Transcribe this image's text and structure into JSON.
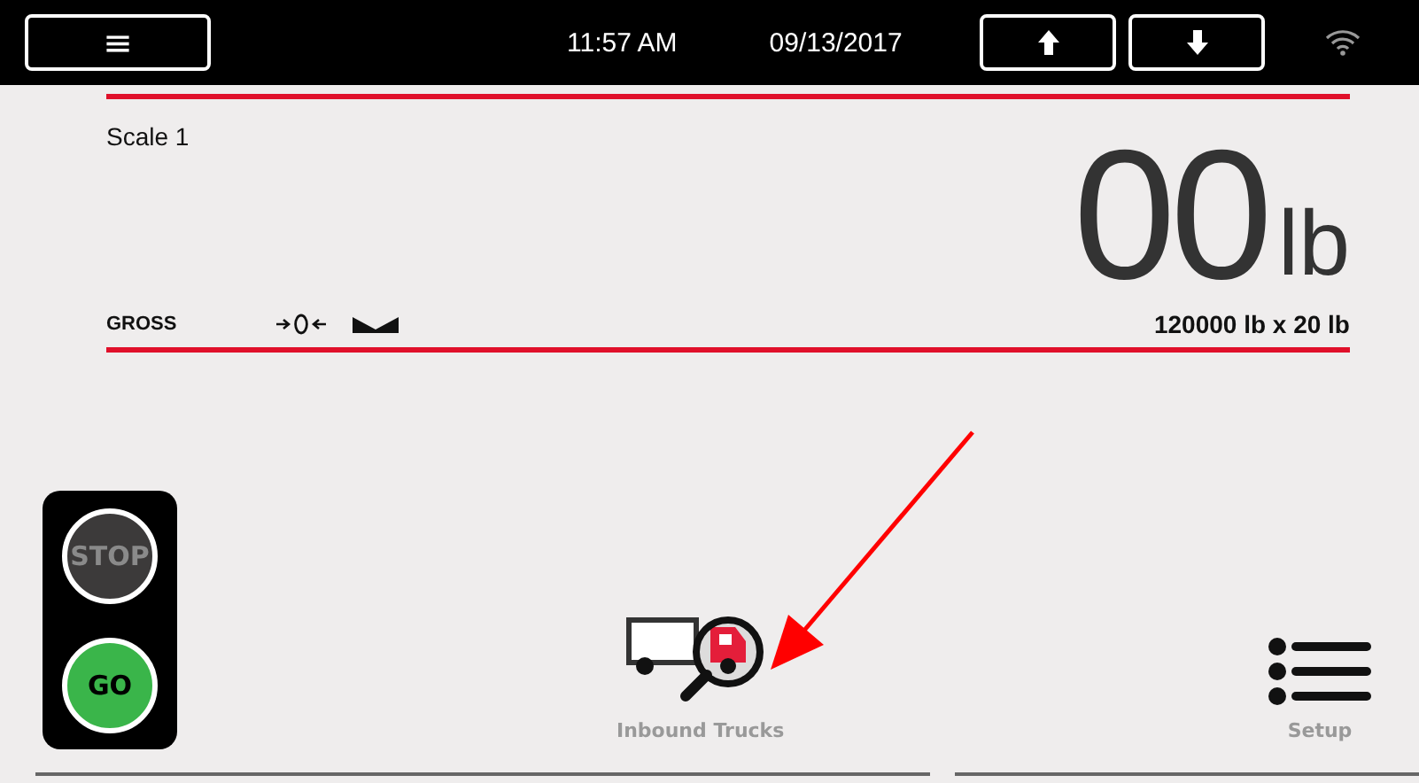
{
  "top_bar": {
    "time": "11:57 AM",
    "date": "09/13/2017",
    "menu_icon": "≡"
  },
  "scale": {
    "name": "Scale 1",
    "weight": "00",
    "unit": "lb",
    "mode": "GROSS",
    "capacity": "120000 lb x 20 lb"
  },
  "traffic_light": [
    {
      "label": "STOP",
      "kind": "stop",
      "lit": false
    },
    {
      "label": "GO",
      "kind": "go",
      "lit": true
    }
  ],
  "actions": [
    {
      "label": "Inbound Trucks",
      "kind": "trucks"
    },
    {
      "label": "Setup",
      "kind": "setup"
    }
  ]
}
